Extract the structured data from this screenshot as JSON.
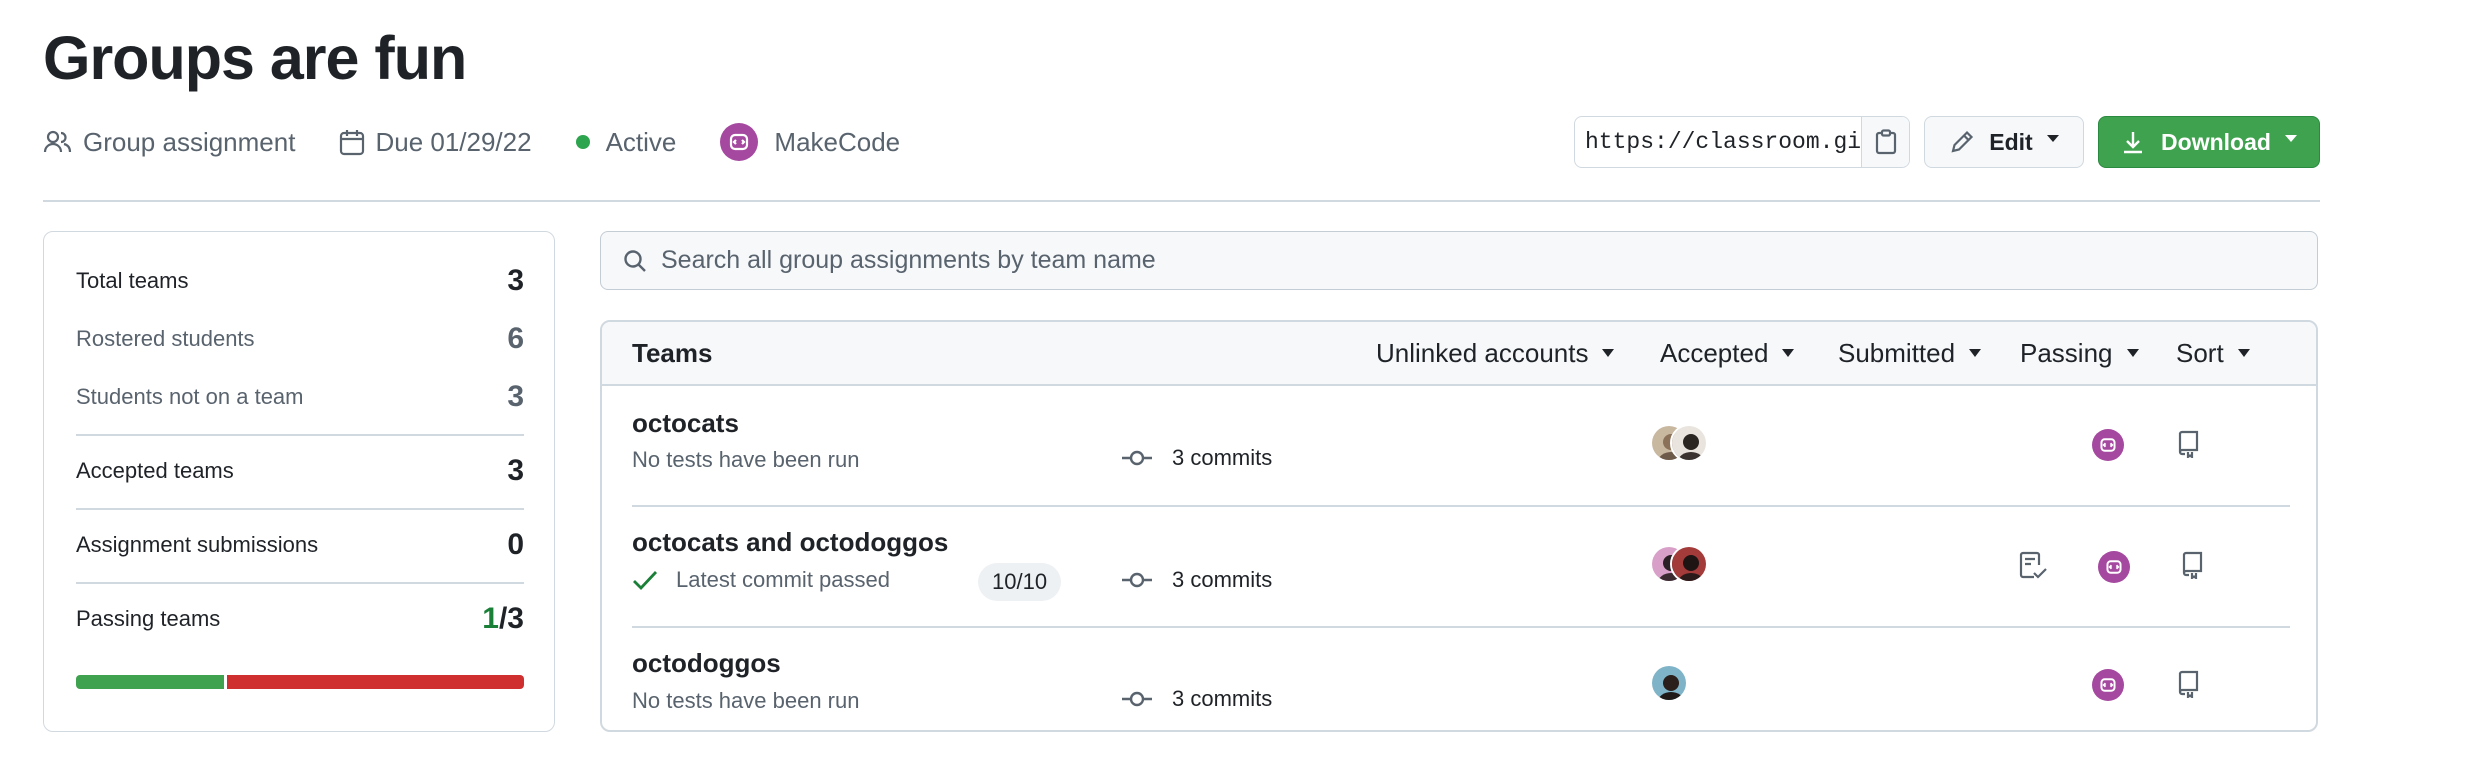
{
  "page": {
    "title": "Groups are fun"
  },
  "meta": {
    "assignment_type": "Group assignment",
    "due": "Due 01/29/22",
    "status": "Active",
    "editor": "MakeCode"
  },
  "actions": {
    "clone_url": "https://classroom.github.com/a/groups-are-fun",
    "edit_label": "Edit",
    "download_label": "Download"
  },
  "stats": {
    "total_teams_label": "Total teams",
    "total_teams": "3",
    "rostered_label": "Rostered students",
    "rostered": "6",
    "not_on_team_label": "Students not on a team",
    "not_on_team": "3",
    "accepted_label": "Accepted teams",
    "accepted": "3",
    "submissions_label": "Assignment submissions",
    "submissions": "0",
    "passing_label": "Passing teams",
    "passing_num": "1",
    "passing_den": "/3",
    "passing_fraction": 0.333
  },
  "search": {
    "placeholder": "Search all group assignments by team name"
  },
  "teams_table": {
    "title": "Teams",
    "filters": [
      "Unlinked accounts",
      "Accepted",
      "Submitted",
      "Passing",
      "Sort"
    ]
  },
  "teams": [
    {
      "name": "octocats",
      "status": "No tests have been run",
      "commits": "3 commits"
    },
    {
      "name": "octocats and octodoggos",
      "status": "Latest commit passed",
      "score": "10/10",
      "commits": "3 commits"
    },
    {
      "name": "octodoggos",
      "status": "No tests have been run",
      "commits": "3 commits"
    }
  ],
  "colors": {
    "accent_green": "#3fa24f",
    "fail_red": "#cf2f2f",
    "makecode_purple": "#a5489f"
  }
}
